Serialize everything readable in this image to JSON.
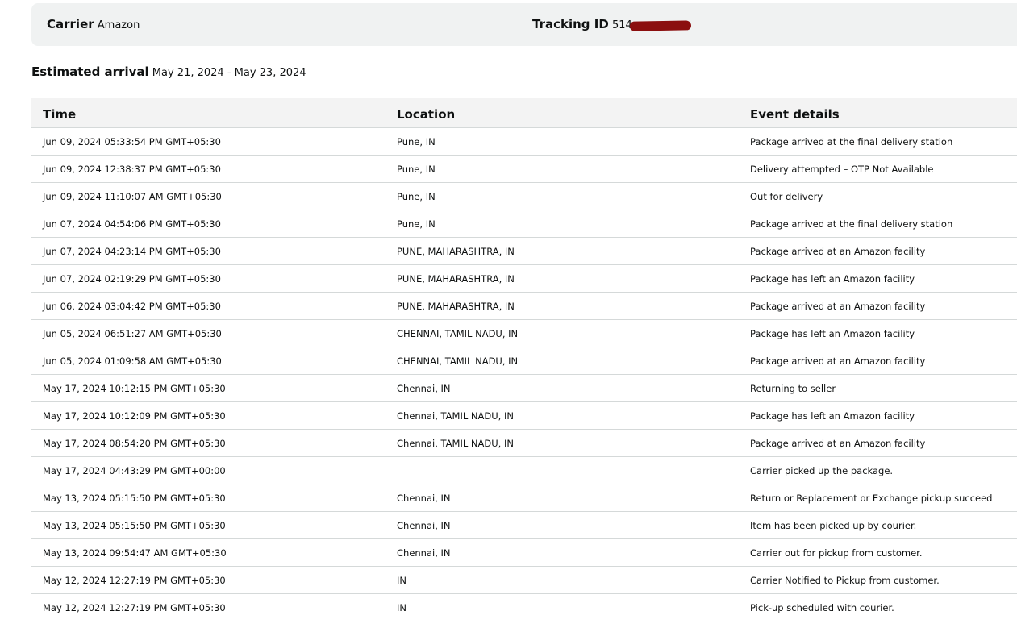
{
  "header": {
    "carrier_label": "Carrier",
    "carrier_value": "Amazon",
    "tracking_label": "Tracking ID",
    "tracking_value_visible": "514"
  },
  "estimate": {
    "label": "Estimated arrival",
    "value": "May 21, 2024 - May 23, 2024"
  },
  "table": {
    "columns": [
      "Time",
      "Location",
      "Event details"
    ],
    "rows": [
      {
        "time": "Jun 09, 2024 05:33:54 PM GMT+05:30",
        "location": "Pune, IN",
        "event": "Package arrived at the final delivery station"
      },
      {
        "time": "Jun 09, 2024 12:38:37 PM GMT+05:30",
        "location": "Pune, IN",
        "event": "Delivery attempted – OTP Not Available"
      },
      {
        "time": "Jun 09, 2024 11:10:07 AM GMT+05:30",
        "location": "Pune, IN",
        "event": "Out for delivery"
      },
      {
        "time": "Jun 07, 2024 04:54:06 PM GMT+05:30",
        "location": "Pune, IN",
        "event": "Package arrived at the final delivery station"
      },
      {
        "time": "Jun 07, 2024 04:23:14 PM GMT+05:30",
        "location": "PUNE, MAHARASHTRA, IN",
        "event": "Package arrived at an Amazon facility"
      },
      {
        "time": "Jun 07, 2024 02:19:29 PM GMT+05:30",
        "location": "PUNE, MAHARASHTRA, IN",
        "event": "Package has left an Amazon facility"
      },
      {
        "time": "Jun 06, 2024 03:04:42 PM GMT+05:30",
        "location": "PUNE, MAHARASHTRA, IN",
        "event": "Package arrived at an Amazon facility"
      },
      {
        "time": "Jun 05, 2024 06:51:27 AM GMT+05:30",
        "location": "CHENNAI, TAMIL NADU, IN",
        "event": "Package has left an Amazon facility"
      },
      {
        "time": "Jun 05, 2024 01:09:58 AM GMT+05:30",
        "location": "CHENNAI, TAMIL NADU, IN",
        "event": "Package arrived at an Amazon facility"
      },
      {
        "time": "May 17, 2024 10:12:15 PM GMT+05:30",
        "location": "Chennai, IN",
        "event": "Returning to seller"
      },
      {
        "time": "May 17, 2024 10:12:09 PM GMT+05:30",
        "location": "Chennai, TAMIL NADU, IN",
        "event": "Package has left an Amazon facility"
      },
      {
        "time": "May 17, 2024 08:54:20 PM GMT+05:30",
        "location": "Chennai, TAMIL NADU, IN",
        "event": "Package arrived at an Amazon facility"
      },
      {
        "time": "May 17, 2024 04:43:29 PM GMT+00:00",
        "location": "",
        "event": "Carrier picked up the package."
      },
      {
        "time": "May 13, 2024 05:15:50 PM GMT+05:30",
        "location": "Chennai, IN",
        "event": "Return or Replacement or Exchange pickup succeed"
      },
      {
        "time": "May 13, 2024 05:15:50 PM GMT+05:30",
        "location": "Chennai, IN",
        "event": "Item has been picked up by courier."
      },
      {
        "time": "May 13, 2024 09:54:47 AM GMT+05:30",
        "location": "Chennai, IN",
        "event": "Carrier out for pickup from customer."
      },
      {
        "time": "May 12, 2024 12:27:19 PM GMT+05:30",
        "location": "IN",
        "event": "Carrier Notified to Pickup from customer."
      },
      {
        "time": "May 12, 2024 12:27:19 PM GMT+05:30",
        "location": "IN",
        "event": "Pick-up scheduled with courier."
      }
    ]
  },
  "colors": {
    "header_bg": "#f0f2f2",
    "table_header_bg": "#f3f3f3",
    "redaction": "#8b0f0f",
    "divider": "#d5d9d9"
  }
}
